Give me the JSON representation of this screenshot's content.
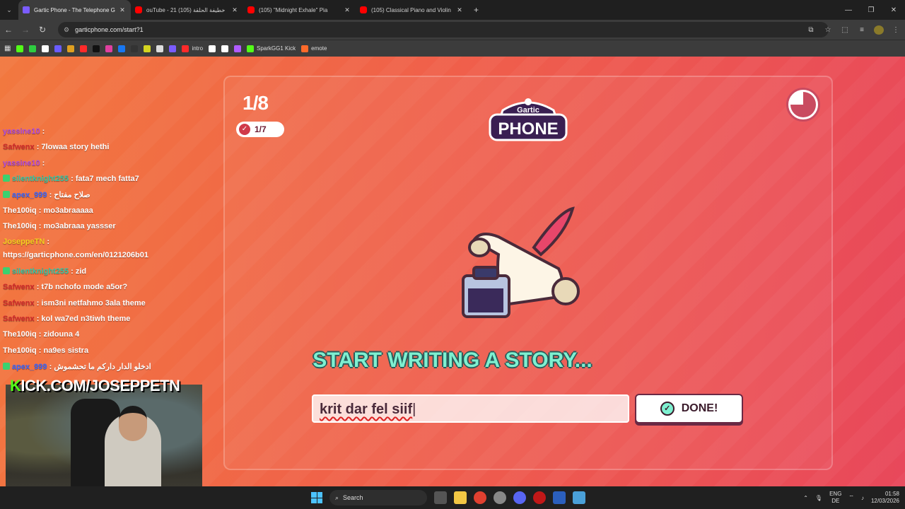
{
  "browser": {
    "tabs": [
      {
        "title": "Gartic Phone - The Telephone G",
        "active": true,
        "icon": "gartic-icon"
      },
      {
        "title": "ouTube - 21 خطيفة الحلقة (105)",
        "active": false,
        "icon": "youtube-icon"
      },
      {
        "title": "(105) \"Midnight Exhale\" Pia",
        "active": false,
        "icon": "youtube-icon"
      },
      {
        "title": "(105) Classical Piano and Violin",
        "active": false,
        "icon": "youtube-icon"
      }
    ],
    "url": "garticphone.com/start?1",
    "bookmarks": [
      {
        "label": "",
        "color": "#53fc18"
      },
      {
        "label": "",
        "color": "#2ecc40"
      },
      {
        "label": "",
        "color": "#ffffff"
      },
      {
        "label": "",
        "color": "#6a5cff"
      },
      {
        "label": "",
        "color": "#e0a020"
      },
      {
        "label": "",
        "color": "#ff2a2a"
      },
      {
        "label": "",
        "color": "#111111"
      },
      {
        "label": "",
        "color": "#e040a0"
      },
      {
        "label": "",
        "color": "#1877f2"
      },
      {
        "label": "",
        "color": "#333333"
      },
      {
        "label": "",
        "color": "#d4d420"
      },
      {
        "label": "",
        "color": "#dddddd"
      },
      {
        "label": "",
        "color": "#7a5cff"
      },
      {
        "label": "intro",
        "color": "#ff2a2a"
      },
      {
        "label": "",
        "color": "#ffffff"
      },
      {
        "label": "",
        "color": "#ffffff"
      },
      {
        "label": "",
        "color": "#b05cff"
      },
      {
        "label": "SparkGG1 Kick",
        "color": "#53fc18"
      },
      {
        "label": "emote",
        "color": "#ff6a2a"
      }
    ]
  },
  "game": {
    "round": "1/8",
    "progress": "1/7",
    "logo_top": "Gartic",
    "logo_bottom": "PHONE",
    "heading": "START WRITING A STORY...",
    "input_value": "krit dar fel siif",
    "done_label": "DONE!",
    "colors": {
      "accent": "#7ef0d0",
      "bg_start": "#f2783f",
      "bg_end": "#e8485b"
    }
  },
  "chat": [
    {
      "user": "yassine10",
      "text": "",
      "color": "purple",
      "badge": false
    },
    {
      "user": "Safwenx",
      "text": "7lowaa story hethi",
      "color": "red",
      "badge": false
    },
    {
      "user": "yassine10",
      "text": "",
      "color": "purple",
      "badge": false
    },
    {
      "user": "silentknight255",
      "text": "fata7 mech fatta7",
      "color": "teal",
      "badge": true
    },
    {
      "user": "apex_999",
      "text": "صلاح مفتاح",
      "color": "blue",
      "badge": true
    },
    {
      "user": "The100iq",
      "text": "mo3abraaaaa",
      "color": "white",
      "badge": false
    },
    {
      "user": "The100iq",
      "text": "mo3abraaa yassser",
      "color": "white",
      "badge": false
    },
    {
      "user": "JoseppeTN",
      "text": "",
      "color": "yellow",
      "badge": false
    },
    {
      "user": "",
      "text": "https://garticphone.com/en/0121206b01",
      "color": "white",
      "badge": false
    },
    {
      "user": "silentknight255",
      "text": "zid",
      "color": "teal",
      "badge": true
    },
    {
      "user": "Safwenx",
      "text": "t7b nchofo mode a5or?",
      "color": "red",
      "badge": false
    },
    {
      "user": "Safwenx",
      "text": "ism3ni netfahmo 3ala theme",
      "color": "red",
      "badge": false
    },
    {
      "user": "Safwenx",
      "text": "kol wa7ed n3tiwh theme",
      "color": "red",
      "badge": false
    },
    {
      "user": "The100iq",
      "text": "zidouna 4",
      "color": "white",
      "badge": false
    },
    {
      "user": "The100iq",
      "text": "na9es sistra",
      "color": "white",
      "badge": false
    },
    {
      "user": "apex_999",
      "text": "ادخلو الدار داركم ما تحشموش",
      "color": "blue",
      "badge": true
    }
  ],
  "stream": {
    "kick_prefix": "K",
    "kick_rest": "ICK.COM/JOSEPPETN"
  },
  "taskbar": {
    "search": "Search",
    "lang_top": "ENG",
    "lang_bottom": "DE",
    "time": "01:58",
    "date": "12/03/2026"
  }
}
